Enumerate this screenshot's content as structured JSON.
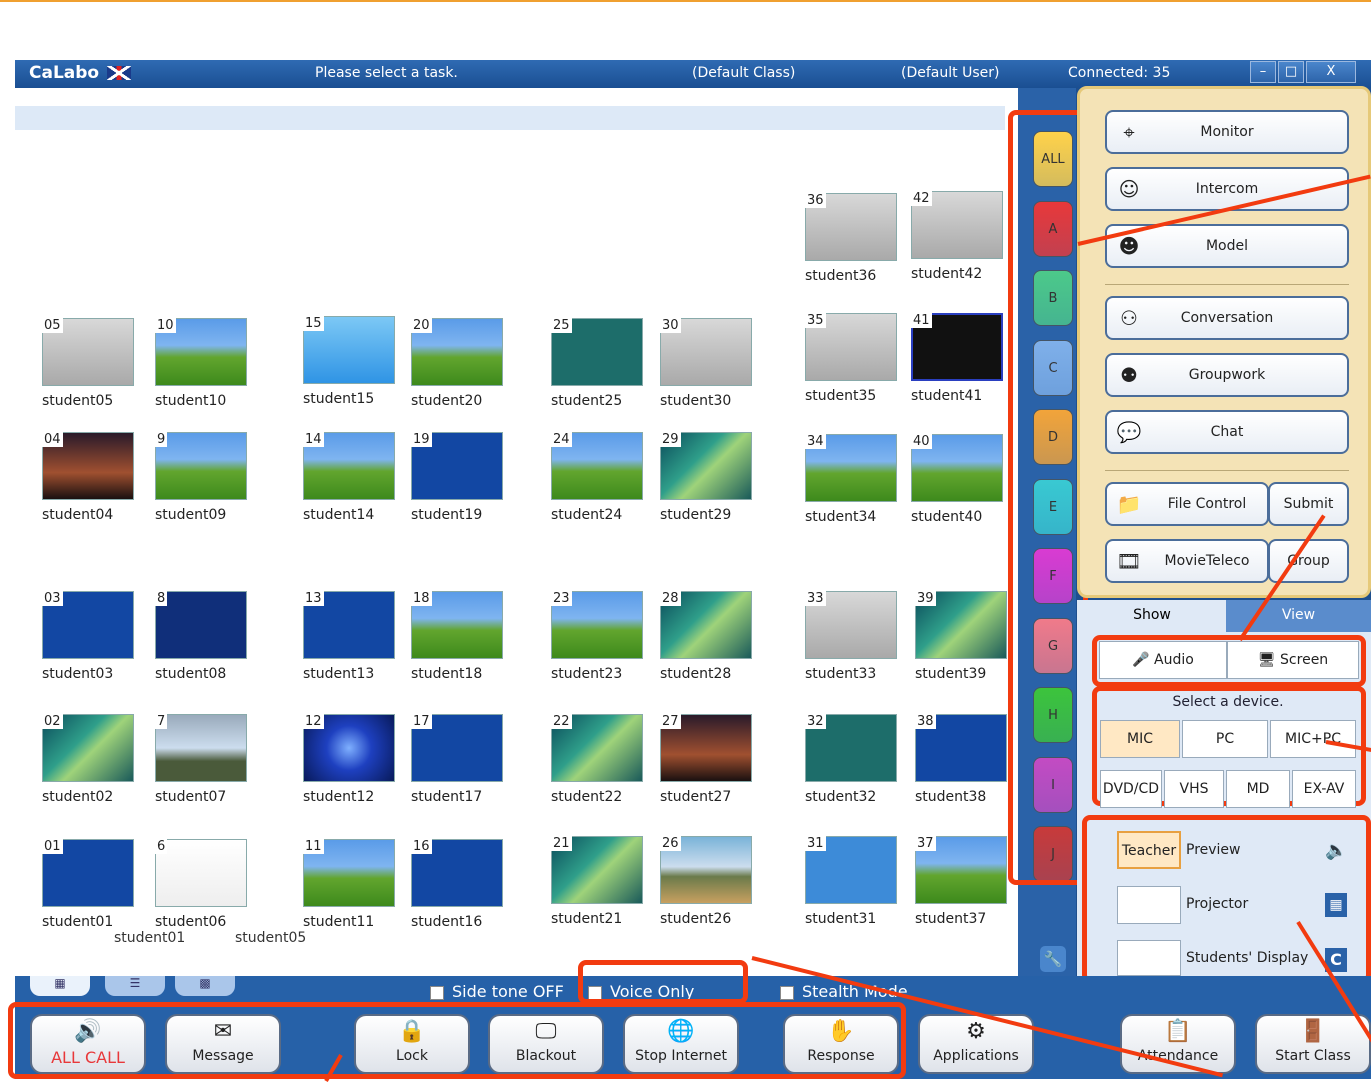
{
  "title_bar": {
    "app_name": "CaLabo",
    "task_prompt": "Please select a task.",
    "class": "(Default Class)",
    "user": "(Default User)",
    "connected": "Connected: 35",
    "minimize": "–",
    "maximize": "□",
    "close": "X"
  },
  "students": [
    {
      "num": "36",
      "name": "student36",
      "thumb": "gray"
    },
    {
      "num": "42",
      "name": "student42",
      "thumb": "gray"
    },
    {
      "num": "05",
      "name": "student05",
      "thumb": "gray"
    },
    {
      "num": "10",
      "name": "student10",
      "thumb": "xp"
    },
    {
      "num": "15",
      "name": "student15",
      "thumb": "lightblue"
    },
    {
      "num": "20",
      "name": "student20",
      "thumb": "xp"
    },
    {
      "num": "25",
      "name": "student25",
      "thumb": "teal"
    },
    {
      "num": "30",
      "name": "student30",
      "thumb": "gray"
    },
    {
      "num": "35",
      "name": "student35",
      "thumb": "gray"
    },
    {
      "num": "41",
      "name": "student41",
      "thumb": "dark"
    },
    {
      "num": "04",
      "name": "student04",
      "thumb": "sunset"
    },
    {
      "num": "9",
      "name": "student09",
      "thumb": "xp"
    },
    {
      "num": "14",
      "name": "student14",
      "thumb": "xp"
    },
    {
      "num": "19",
      "name": "student19",
      "thumb": "blue"
    },
    {
      "num": "24",
      "name": "student24",
      "thumb": "xp"
    },
    {
      "num": "29",
      "name": "student29",
      "thumb": "vista"
    },
    {
      "num": "34",
      "name": "student34",
      "thumb": "xp"
    },
    {
      "num": "40",
      "name": "student40",
      "thumb": "xp"
    },
    {
      "num": "03",
      "name": "student03",
      "thumb": "blue"
    },
    {
      "num": "8",
      "name": "student08",
      "thumb": "navy"
    },
    {
      "num": "13",
      "name": "student13",
      "thumb": "blue"
    },
    {
      "num": "18",
      "name": "student18",
      "thumb": "xp"
    },
    {
      "num": "23",
      "name": "student23",
      "thumb": "xp"
    },
    {
      "num": "28",
      "name": "student28",
      "thumb": "vista"
    },
    {
      "num": "33",
      "name": "student33",
      "thumb": "gray"
    },
    {
      "num": "39",
      "name": "student39",
      "thumb": "vista"
    },
    {
      "num": "02",
      "name": "student02",
      "thumb": "vista"
    },
    {
      "num": "7",
      "name": "student07",
      "thumb": "stone"
    },
    {
      "num": "12",
      "name": "student12",
      "thumb": "burst"
    },
    {
      "num": "17",
      "name": "student17",
      "thumb": "blue"
    },
    {
      "num": "22",
      "name": "student22",
      "thumb": "vista"
    },
    {
      "num": "27",
      "name": "student27",
      "thumb": "sunset"
    },
    {
      "num": "32",
      "name": "student32",
      "thumb": "teal"
    },
    {
      "num": "38",
      "name": "student38",
      "thumb": "blue"
    },
    {
      "num": "01",
      "name": "student01",
      "thumb": "blue"
    },
    {
      "num": "6",
      "name": "student06",
      "thumb": "window"
    },
    {
      "num": "11",
      "name": "student11",
      "thumb": "xp"
    },
    {
      "num": "16",
      "name": "student16",
      "thumb": "blue"
    },
    {
      "num": "21",
      "name": "student21",
      "thumb": "vista"
    },
    {
      "num": "26",
      "name": "student26",
      "thumb": "mountain"
    },
    {
      "num": "31",
      "name": "student31",
      "thumb": "sky"
    },
    {
      "num": "37",
      "name": "student37",
      "thumb": "xp"
    }
  ],
  "overlap_labels": {
    "a": "student01",
    "b": "student05"
  },
  "groups": [
    {
      "label": "ALL",
      "color": "#ffd24a"
    },
    {
      "label": "A",
      "color": "#e8383a"
    },
    {
      "label": "B",
      "color": "#4cc98a"
    },
    {
      "label": "C",
      "color": "#7fb0ea"
    },
    {
      "label": "D",
      "color": "#f2a43a"
    },
    {
      "label": "E",
      "color": "#39c9d2"
    },
    {
      "label": "F",
      "color": "#d93bd2"
    },
    {
      "label": "G",
      "color": "#f07a8a"
    },
    {
      "label": "H",
      "color": "#3cc43c"
    },
    {
      "label": "I",
      "color": "#c34bc3"
    },
    {
      "label": "J",
      "color": "#c83a3a"
    }
  ],
  "tasks": {
    "monitor": "Monitor",
    "intercom": "Intercom",
    "model": "Model",
    "conversation": "Conversation",
    "groupwork": "Groupwork",
    "chat": "Chat",
    "file_control": "File Control",
    "submit": "Submit",
    "movieteleco": "MovieTeleco",
    "group": "Group"
  },
  "mode_tabs": {
    "show": "Show",
    "view": "View"
  },
  "show_options": {
    "audio": "Audio",
    "screen": "Screen"
  },
  "device": {
    "title": "Select a device.",
    "row1": [
      "MIC",
      "PC",
      "MIC+PC"
    ],
    "row2": [
      "DVD/CD",
      "VHS",
      "MD",
      "EX-AV"
    ]
  },
  "outputs": {
    "teacher": "Teacher",
    "preview": "Preview",
    "projector": "Projector",
    "students_display": "Students' Display"
  },
  "options": {
    "side_tone": "Side tone OFF",
    "voice_only": "Voice Only",
    "stealth": "Stealth Mode"
  },
  "bottom_buttons": {
    "all_call": "ALL CALL",
    "message": "Message",
    "lock": "Lock",
    "blackout": "Blackout",
    "stop_internet": "Stop Internet",
    "response": "Response",
    "applications": "Applications",
    "attendance": "Attendance",
    "start_class": "Start Class"
  },
  "colors": {
    "highlight": "#f23b10",
    "window_blue": "#1e4f8e",
    "panel": "#f4e3b6",
    "all_call_text": "#e8383a"
  }
}
